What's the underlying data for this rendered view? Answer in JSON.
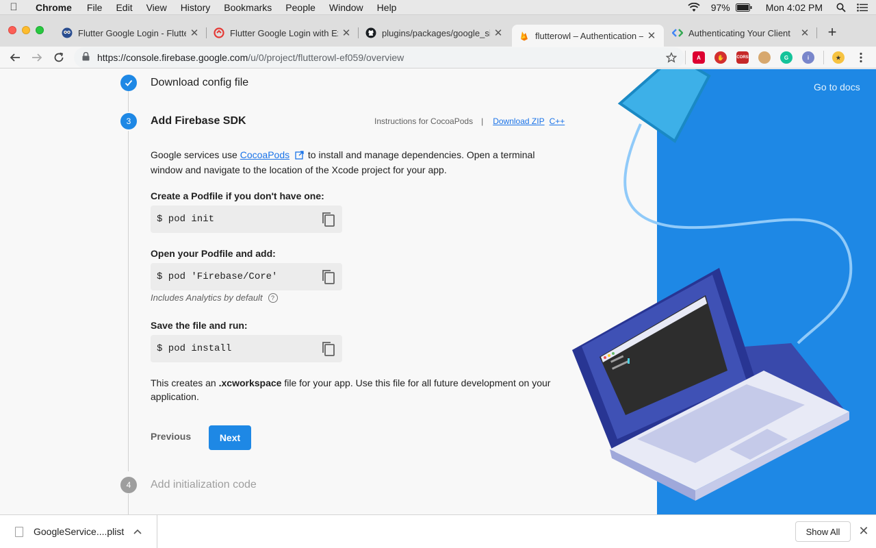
{
  "menubar": {
    "app": "Chrome",
    "items": [
      "File",
      "Edit",
      "View",
      "History",
      "Bookmarks",
      "People",
      "Window",
      "Help"
    ],
    "battery": "97%",
    "clock": "Mon 4:02 PM"
  },
  "tabs": [
    {
      "title": "Flutter Google Login - Flutte",
      "favicon": "owl-icon"
    },
    {
      "title": "Flutter Google Login with Ex",
      "favicon": "codingwithdhrumil-icon"
    },
    {
      "title": "plugins/packages/google_si",
      "favicon": "github-icon"
    },
    {
      "title": "flutterowl – Authentication –",
      "favicon": "firebase-icon",
      "active": true
    },
    {
      "title": "Authenticating Your Client",
      "favicon": "google-developers-icon"
    }
  ],
  "address": {
    "host": "https://console.firebase.google.com",
    "path": "/u/0/project/flutterowl-ef059/overview"
  },
  "page": {
    "go_to_docs": "Go to docs",
    "step2_title": "Download config file",
    "step3_number": "3",
    "step3_title": "Add Firebase SDK",
    "instructions_label": "Instructions for CocoaPods",
    "pipe": "|",
    "download_zip": "Download ZIP",
    "cpp": "C++",
    "intro_prefix": "Google services use ",
    "intro_link": "CocoaPods",
    "intro_suffix": " to install and manage dependencies. Open a terminal window and navigate to the location of the Xcode project for your app.",
    "label_create": "Create a Podfile if you don't have one:",
    "code_init": "$ pod init",
    "label_open": "Open your Podfile and add:",
    "code_core": "$ pod 'Firebase/Core'",
    "hint_analytics": "Includes Analytics by default",
    "label_save": "Save the file and run:",
    "code_install": "$ pod install",
    "outro_prefix": "This creates an ",
    "outro_bold": ".xcworkspace",
    "outro_suffix": " file for your app. Use this file for all future development on your application.",
    "previous": "Previous",
    "next": "Next",
    "step4_number": "4",
    "step4_title": "Add initialization code"
  },
  "download_bar": {
    "filename": "GoogleService....plist",
    "show_all": "Show All"
  },
  "colors": {
    "accent": "#1e88e5",
    "link": "#1a73e8",
    "illustration_bg": "#1e88e5"
  }
}
